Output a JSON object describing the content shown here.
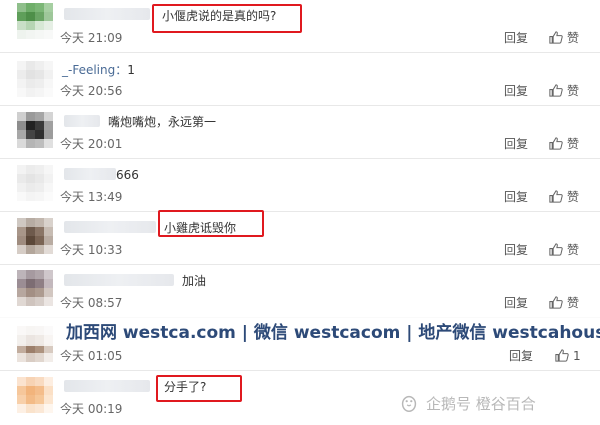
{
  "reply_label": "回复",
  "like_label": "赞",
  "comments": [
    {
      "id": "c1",
      "prefix": "",
      "text": "小偃虎说的是真的吗?",
      "time": "今天 21:09",
      "highlighted": true,
      "like_count": ""
    },
    {
      "id": "c2",
      "prefix": "_-Feeling：",
      "text": "1",
      "time": "今天 20:56",
      "highlighted": false,
      "like_count": ""
    },
    {
      "id": "c3",
      "prefix": "",
      "text": "嘴炮嘴炮，永远第一",
      "time": "今天 20:01",
      "highlighted": false,
      "like_count": ""
    },
    {
      "id": "c4",
      "prefix": "",
      "text": "666",
      "time": "今天 13:49",
      "highlighted": false,
      "like_count": ""
    },
    {
      "id": "c5",
      "prefix": "",
      "text": "小雞虎诋毁你",
      "time": "今天 10:33",
      "highlighted": true,
      "like_count": ""
    },
    {
      "id": "c6",
      "prefix": "",
      "text": "加油",
      "time": "今天 08:57",
      "highlighted": false,
      "like_count": ""
    },
    {
      "id": "c7",
      "prefix": "",
      "text": "",
      "time": "今天 01:05",
      "highlighted": false,
      "like_count": "1"
    },
    {
      "id": "c8",
      "prefix": "",
      "text": "分手了?",
      "time": "今天 00:19",
      "highlighted": true,
      "like_count": ""
    }
  ],
  "watermark": "加西网 westca.com | 微信 westcacom | 地产微信 westcahouse",
  "corner_mark": "企鹅号 橙谷百合",
  "colors": {
    "highlight_red": "#e0191f",
    "watermark_blue": "#2d4a78"
  }
}
